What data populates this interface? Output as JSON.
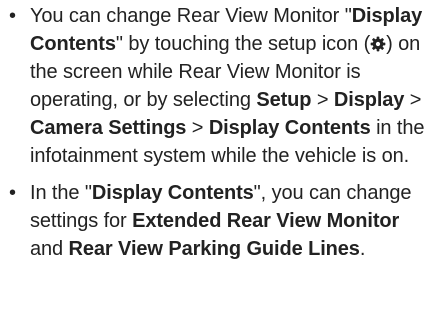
{
  "bullet_symbol": "•",
  "item1": {
    "t1": "You can change Rear View Monitor ",
    "t2": "\"",
    "t3": "Display Contents",
    "t4": "\" by touching the setup icon (",
    "t5": ") on the screen while Rear View Monitor is operating, or by selecting ",
    "t6": "Setup",
    "t7": " > ",
    "t8": "Display",
    "t9": " > ",
    "t10": "Camera Settings",
    "t11": " > ",
    "t12": "Display Contents",
    "t13": " in the infotainment system while the vehicle is on."
  },
  "item2": {
    "t1": "In the \"",
    "t2": "Display Contents",
    "t3": "\", you can change settings for ",
    "t4": "Extended Rear View Monitor",
    "t5": " and ",
    "t6": "Rear View Parking Guide Lines",
    "t7": "."
  },
  "icons": {
    "setup": "gear-icon"
  }
}
